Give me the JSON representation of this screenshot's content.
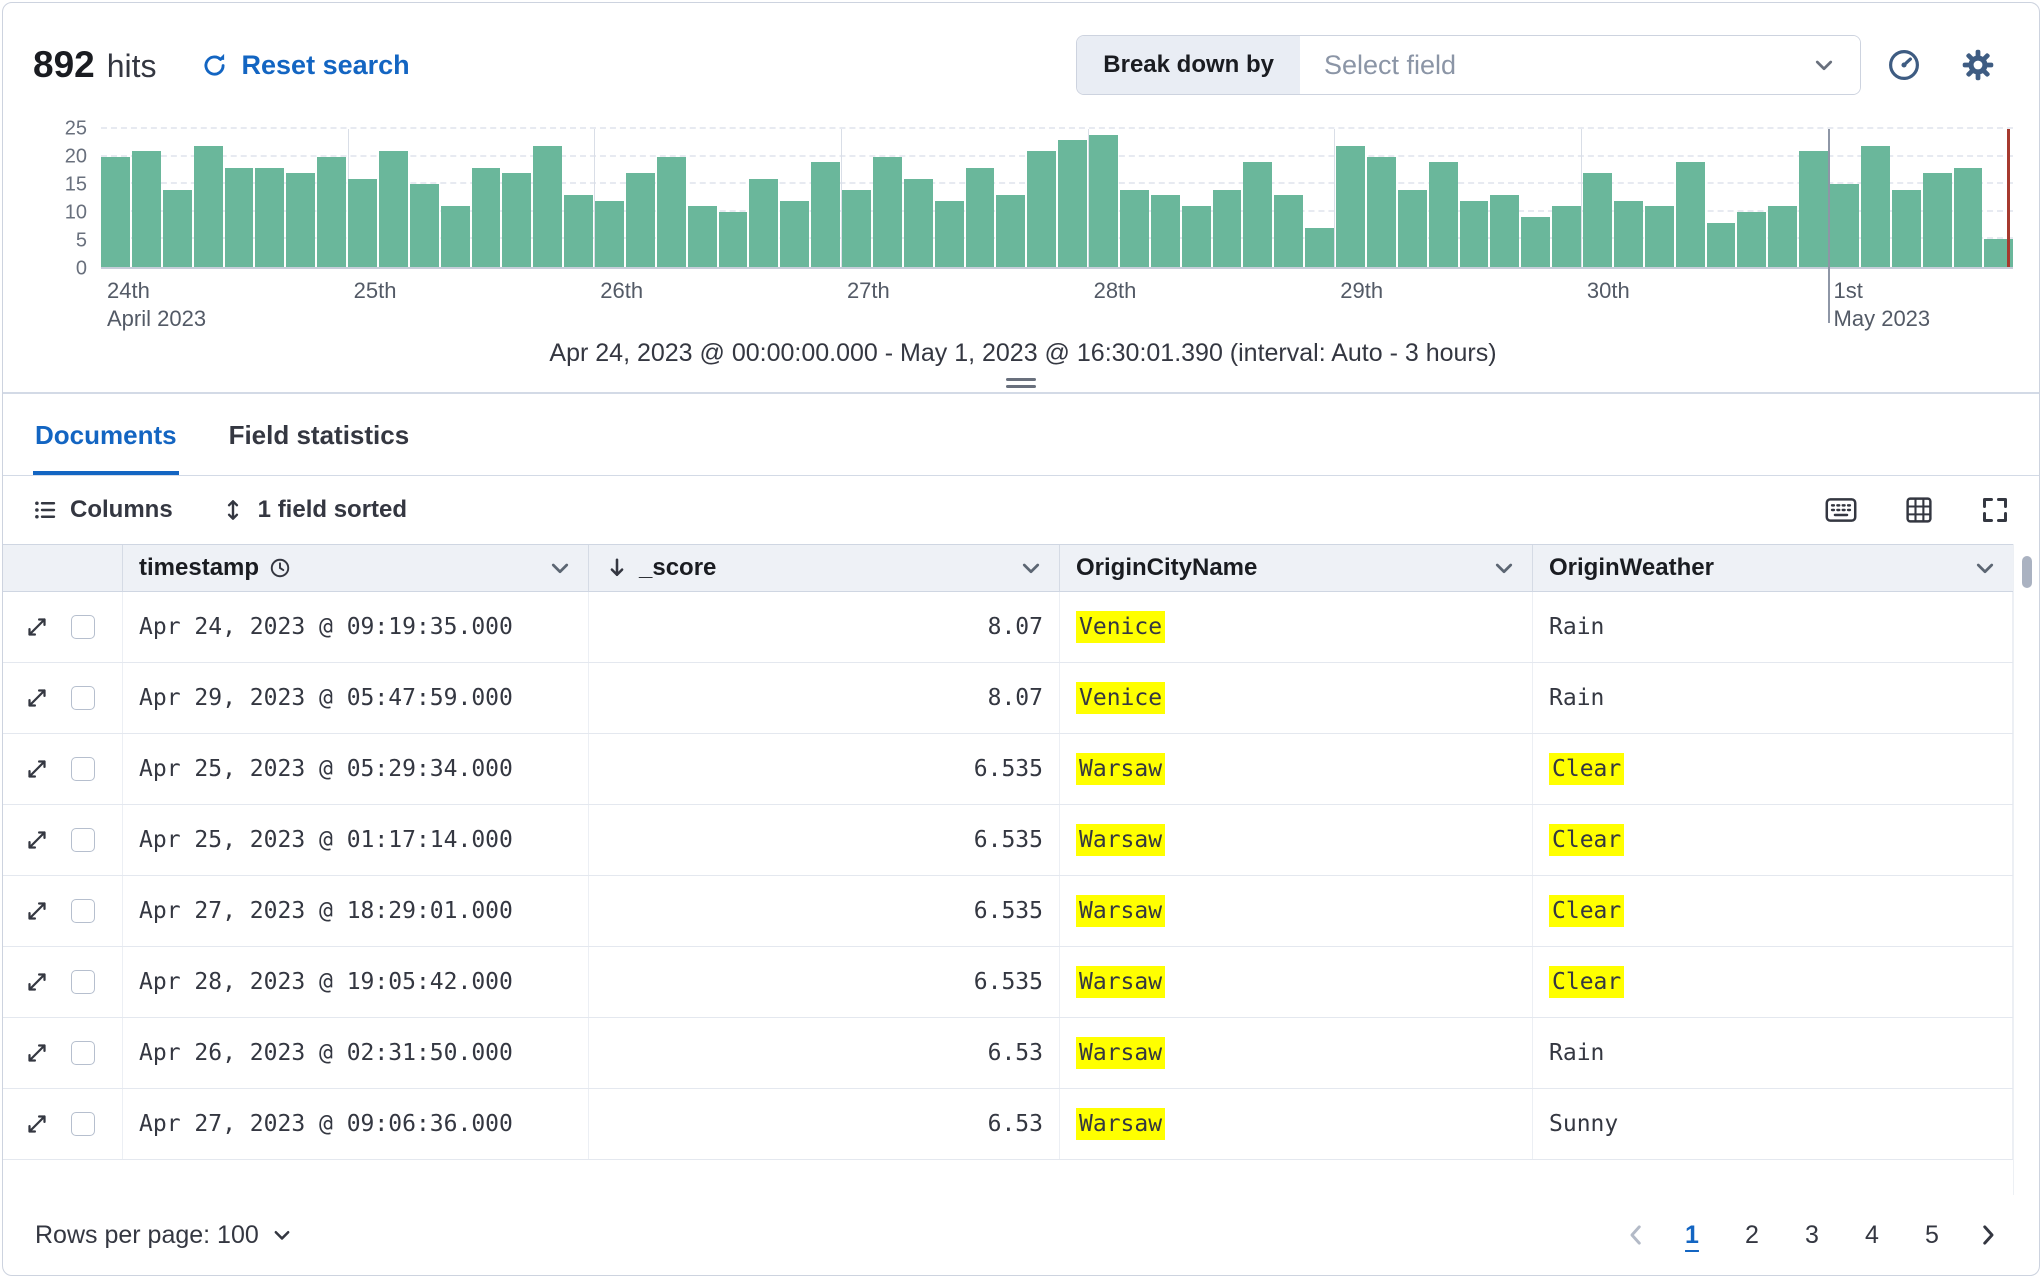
{
  "header": {
    "hits_count": "892",
    "hits_label": "hits",
    "reset_search_label": "Reset search",
    "breakdown_label": "Break down by",
    "breakdown_placeholder": "Select field"
  },
  "chart_data": {
    "type": "bar",
    "title": "",
    "xlabel": "",
    "ylabel": "",
    "ylim": [
      0,
      25
    ],
    "y_ticks": [
      0,
      5,
      10,
      15,
      20,
      25
    ],
    "interval": "Auto - 3 hours",
    "bar_color": "#6ab79b",
    "end_marker_color": "#a6392e",
    "values": [
      20,
      21,
      14,
      22,
      18,
      18,
      17,
      20,
      16,
      21,
      15,
      11,
      18,
      17,
      22,
      13,
      12,
      17,
      20,
      11,
      10,
      16,
      12,
      19,
      14,
      20,
      16,
      12,
      18,
      13,
      21,
      23,
      24,
      14,
      13,
      11,
      14,
      19,
      13,
      7,
      22,
      20,
      14,
      19,
      12,
      13,
      9,
      11,
      17,
      12,
      11,
      19,
      8,
      10,
      11,
      21,
      15,
      22,
      14,
      17,
      18,
      5
    ],
    "x_ticks": [
      {
        "label": "24th",
        "sublabel": "April 2023",
        "frac": 0,
        "month_boundary": false
      },
      {
        "label": "25th",
        "sublabel": "",
        "frac": 0.129,
        "month_boundary": false
      },
      {
        "label": "26th",
        "sublabel": "",
        "frac": 0.258,
        "month_boundary": false
      },
      {
        "label": "27th",
        "sublabel": "",
        "frac": 0.387,
        "month_boundary": false
      },
      {
        "label": "28th",
        "sublabel": "",
        "frac": 0.516,
        "month_boundary": false
      },
      {
        "label": "29th",
        "sublabel": "",
        "frac": 0.645,
        "month_boundary": false
      },
      {
        "label": "30th",
        "sublabel": "",
        "frac": 0.774,
        "month_boundary": false
      },
      {
        "label": "1st",
        "sublabel": "May 2023",
        "frac": 0.903,
        "month_boundary": true
      }
    ],
    "caption": "Apr 24, 2023 @ 00:00:00.000 - May 1, 2023 @ 16:30:01.390 (interval: Auto - 3 hours)"
  },
  "tabs": {
    "documents": "Documents",
    "field_statistics": "Field statistics"
  },
  "toolbar": {
    "columns_label": "Columns",
    "sorted_label": "1 field sorted"
  },
  "table": {
    "columns": {
      "timestamp": "timestamp",
      "score": "_score",
      "city": "OriginCityName",
      "weather": "OriginWeather"
    },
    "rows": [
      {
        "timestamp": "Apr 24, 2023 @ 09:19:35.000",
        "score": "8.07",
        "city": "Venice",
        "city_highlighted": true,
        "weather": "Rain",
        "weather_highlighted": false
      },
      {
        "timestamp": "Apr 29, 2023 @ 05:47:59.000",
        "score": "8.07",
        "city": "Venice",
        "city_highlighted": true,
        "weather": "Rain",
        "weather_highlighted": false
      },
      {
        "timestamp": "Apr 25, 2023 @ 05:29:34.000",
        "score": "6.535",
        "city": "Warsaw",
        "city_highlighted": true,
        "weather": "Clear",
        "weather_highlighted": true
      },
      {
        "timestamp": "Apr 25, 2023 @ 01:17:14.000",
        "score": "6.535",
        "city": "Warsaw",
        "city_highlighted": true,
        "weather": "Clear",
        "weather_highlighted": true
      },
      {
        "timestamp": "Apr 27, 2023 @ 18:29:01.000",
        "score": "6.535",
        "city": "Warsaw",
        "city_highlighted": true,
        "weather": "Clear",
        "weather_highlighted": true
      },
      {
        "timestamp": "Apr 28, 2023 @ 19:05:42.000",
        "score": "6.535",
        "city": "Warsaw",
        "city_highlighted": true,
        "weather": "Clear",
        "weather_highlighted": true
      },
      {
        "timestamp": "Apr 26, 2023 @ 02:31:50.000",
        "score": "6.53",
        "city": "Warsaw",
        "city_highlighted": true,
        "weather": "Rain",
        "weather_highlighted": false
      },
      {
        "timestamp": "Apr 27, 2023 @ 09:06:36.000",
        "score": "6.53",
        "city": "Warsaw",
        "city_highlighted": true,
        "weather": "Sunny",
        "weather_highlighted": false
      }
    ]
  },
  "footer": {
    "rows_per_page_label": "Rows per page: 100",
    "pages": [
      "1",
      "2",
      "3",
      "4",
      "5"
    ],
    "active_page": "1"
  },
  "colors": {
    "accent": "#1365c2",
    "highlight": "#ffff00",
    "bar": "#6ab79b",
    "header_bg": "#eef1f6"
  }
}
